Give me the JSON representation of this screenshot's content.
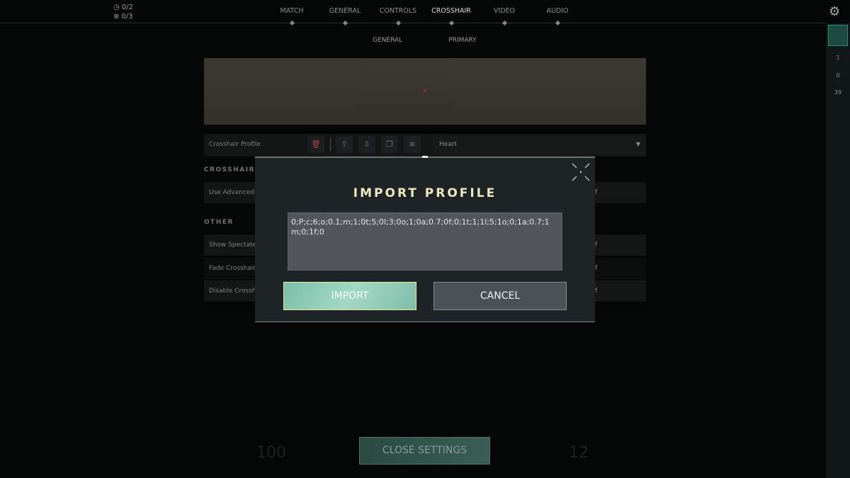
{
  "status": {
    "timer": "0/2",
    "spike": "0/3"
  },
  "nav": {
    "tabs": [
      {
        "label": "MATCH"
      },
      {
        "label": "GENERAL"
      },
      {
        "label": "CONTROLS"
      },
      {
        "label": "CROSSHAIR",
        "active": true
      },
      {
        "label": "VIDEO"
      },
      {
        "label": "AUDIO"
      }
    ],
    "subtabs": [
      {
        "label": "GENERAL"
      },
      {
        "label": "PRIMARY"
      }
    ]
  },
  "profile": {
    "label": "Crosshair Profile",
    "selected": "Heart"
  },
  "sections": {
    "crosshair": "CROSSHAIR",
    "other": "OTHER"
  },
  "rows": {
    "advanced": "Use Advanced O",
    "spectated": "Show Spectated",
    "fade": "Fade Crosshair W",
    "disable": "Disable Crossha",
    "value_fragment": "f"
  },
  "sidebar": {
    "stats": [
      "1",
      "0",
      "39"
    ]
  },
  "modal": {
    "title": "IMPORT PROFILE",
    "code": "0;P;c;6;o;0.1;m;1;0t;5;0l;3;0o;1;0a;0.7;0f;0;1t;1;1l;5;1o;0;1a;0.7;1m;0;1f;0",
    "import_label": "IMPORT",
    "cancel_label": "CANCEL"
  },
  "footer": {
    "close_settings": "CLOSE SETTINGS",
    "bg_left": "100",
    "bg_right": "12"
  },
  "colors": {
    "accent": "#a2d8c5",
    "title": "#ece8c0",
    "delete": "#b04040"
  }
}
